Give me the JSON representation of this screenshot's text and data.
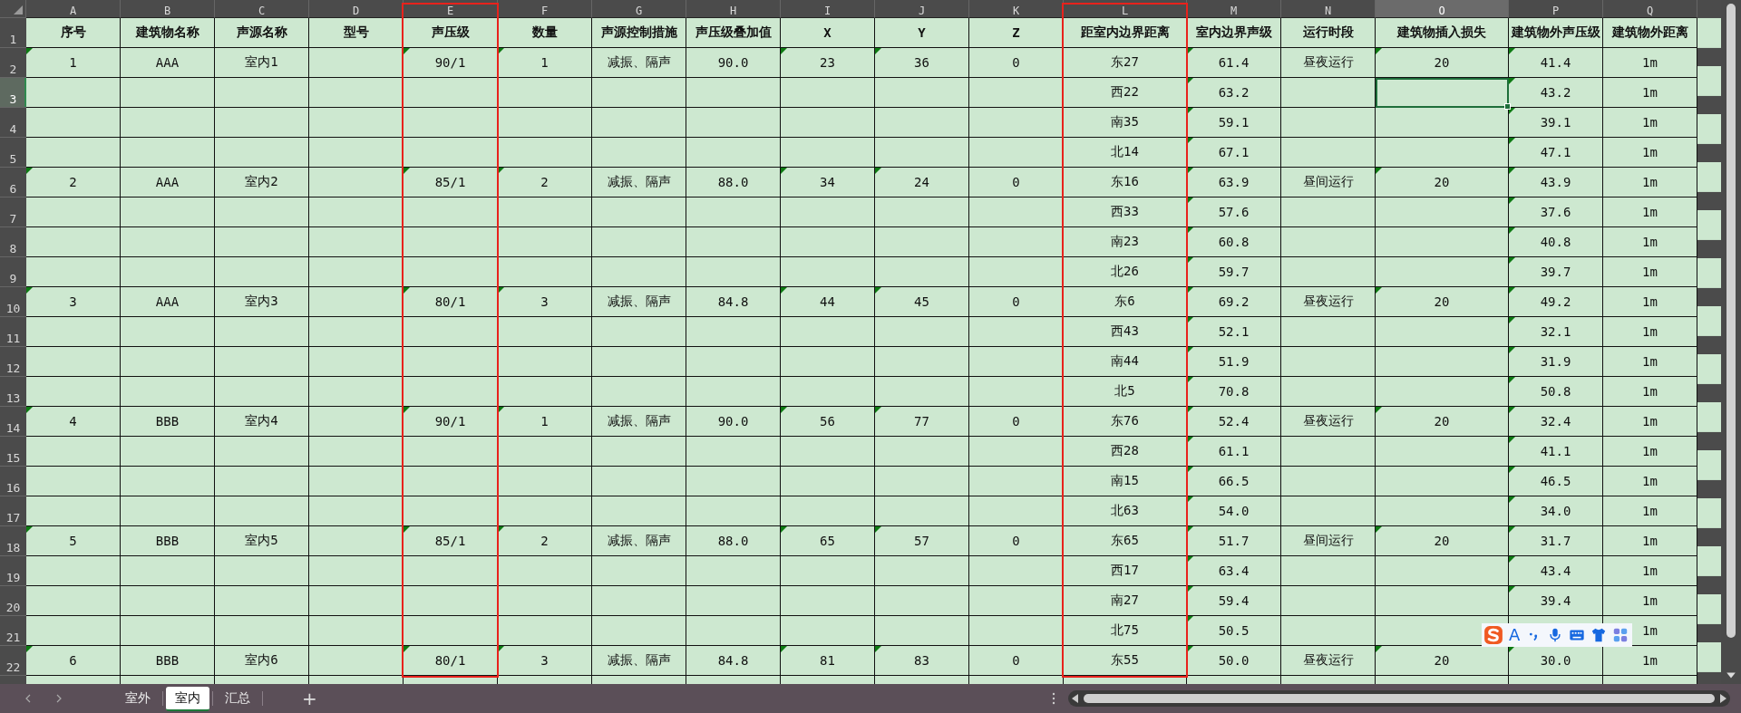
{
  "columns": [
    {
      "letter": "A",
      "selected": false,
      "highlighted": false
    },
    {
      "letter": "B",
      "selected": false,
      "highlighted": false
    },
    {
      "letter": "C",
      "selected": false,
      "highlighted": false
    },
    {
      "letter": "D",
      "selected": false,
      "highlighted": false
    },
    {
      "letter": "E",
      "selected": false,
      "highlighted": true
    },
    {
      "letter": "F",
      "selected": false,
      "highlighted": false
    },
    {
      "letter": "G",
      "selected": false,
      "highlighted": false
    },
    {
      "letter": "H",
      "selected": false,
      "highlighted": false
    },
    {
      "letter": "I",
      "selected": false,
      "highlighted": false
    },
    {
      "letter": "J",
      "selected": false,
      "highlighted": false
    },
    {
      "letter": "K",
      "selected": false,
      "highlighted": false
    },
    {
      "letter": "L",
      "selected": false,
      "highlighted": true
    },
    {
      "letter": "M",
      "selected": false,
      "highlighted": false
    },
    {
      "letter": "N",
      "selected": false,
      "highlighted": false
    },
    {
      "letter": "O",
      "selected": true,
      "highlighted": false
    },
    {
      "letter": "P",
      "selected": false,
      "highlighted": false
    },
    {
      "letter": "Q",
      "selected": false,
      "highlighted": false
    }
  ],
  "rows": [
    {
      "number": "1",
      "kind": "header",
      "selected": false,
      "cells": {
        "A": "序号",
        "B": "建筑物名称",
        "C": "声源名称",
        "D": "型号",
        "E": "声压级",
        "F": "数量",
        "G": "声源控制措施",
        "H": "声压级叠加值",
        "I": "X",
        "J": "Y",
        "K": "Z",
        "L": "距室内边界距离",
        "M": "室内边界声级",
        "N": "运行时段",
        "O": "建筑物插入损失",
        "P": "建筑物外声压级",
        "Q": "建筑物外距离"
      },
      "markers": {}
    },
    {
      "number": "2",
      "kind": "data",
      "selected": false,
      "cells": {
        "A": "1",
        "B": "AAA",
        "C": "室内1",
        "E": "90/1",
        "F": "1",
        "G": "减振、隔声",
        "H": "90.0",
        "I": "23",
        "J": "36",
        "K": "0",
        "L": "东27",
        "M": "61.4",
        "N": "昼夜运行",
        "O": "20",
        "P": "41.4",
        "Q": "1m"
      },
      "markers": {
        "A": true,
        "E": true,
        "F": true,
        "I": true,
        "J": true,
        "M": true,
        "O": true,
        "P": true
      }
    },
    {
      "number": "3",
      "kind": "data",
      "selected": true,
      "cells": {
        "L": "西22",
        "M": "63.2",
        "P": "43.2",
        "Q": "1m"
      },
      "markers": {
        "M": true,
        "P": true
      }
    },
    {
      "number": "4",
      "kind": "data",
      "selected": false,
      "cells": {
        "L": "南35",
        "M": "59.1",
        "P": "39.1",
        "Q": "1m"
      },
      "markers": {
        "M": true,
        "P": true
      }
    },
    {
      "number": "5",
      "kind": "data",
      "selected": false,
      "cells": {
        "L": "北14",
        "M": "67.1",
        "P": "47.1",
        "Q": "1m"
      },
      "markers": {
        "M": true,
        "P": true
      }
    },
    {
      "number": "6",
      "kind": "data",
      "selected": false,
      "cells": {
        "A": "2",
        "B": "AAA",
        "C": "室内2",
        "E": "85/1",
        "F": "2",
        "G": "减振、隔声",
        "H": "88.0",
        "I": "34",
        "J": "24",
        "K": "0",
        "L": "东16",
        "M": "63.9",
        "N": "昼间运行",
        "O": "20",
        "P": "43.9",
        "Q": "1m"
      },
      "markers": {
        "A": true,
        "E": true,
        "F": true,
        "I": true,
        "J": true,
        "M": true,
        "O": true,
        "P": true
      }
    },
    {
      "number": "7",
      "kind": "data",
      "selected": false,
      "cells": {
        "L": "西33",
        "M": "57.6",
        "P": "37.6",
        "Q": "1m"
      },
      "markers": {
        "M": true,
        "P": true
      }
    },
    {
      "number": "8",
      "kind": "data",
      "selected": false,
      "cells": {
        "L": "南23",
        "M": "60.8",
        "P": "40.8",
        "Q": "1m"
      },
      "markers": {
        "M": true,
        "P": true
      }
    },
    {
      "number": "9",
      "kind": "data",
      "selected": false,
      "cells": {
        "L": "北26",
        "M": "59.7",
        "P": "39.7",
        "Q": "1m"
      },
      "markers": {
        "M": true,
        "P": true
      }
    },
    {
      "number": "10",
      "kind": "data",
      "selected": false,
      "cells": {
        "A": "3",
        "B": "AAA",
        "C": "室内3",
        "E": "80/1",
        "F": "3",
        "G": "减振、隔声",
        "H": "84.8",
        "I": "44",
        "J": "45",
        "K": "0",
        "L": "东6",
        "M": "69.2",
        "N": "昼夜运行",
        "O": "20",
        "P": "49.2",
        "Q": "1m"
      },
      "markers": {
        "A": true,
        "E": true,
        "F": true,
        "I": true,
        "J": true,
        "M": true,
        "O": true,
        "P": true
      }
    },
    {
      "number": "11",
      "kind": "data",
      "selected": false,
      "cells": {
        "L": "西43",
        "M": "52.1",
        "P": "32.1",
        "Q": "1m"
      },
      "markers": {
        "M": true,
        "P": true
      }
    },
    {
      "number": "12",
      "kind": "data",
      "selected": false,
      "cells": {
        "L": "南44",
        "M": "51.9",
        "P": "31.9",
        "Q": "1m"
      },
      "markers": {
        "M": true,
        "P": true
      }
    },
    {
      "number": "13",
      "kind": "data",
      "selected": false,
      "cells": {
        "L": "北5",
        "M": "70.8",
        "P": "50.8",
        "Q": "1m"
      },
      "markers": {
        "M": true,
        "P": true
      }
    },
    {
      "number": "14",
      "kind": "data",
      "selected": false,
      "cells": {
        "A": "4",
        "B": "BBB",
        "C": "室内4",
        "E": "90/1",
        "F": "1",
        "G": "减振、隔声",
        "H": "90.0",
        "I": "56",
        "J": "77",
        "K": "0",
        "L": "东76",
        "M": "52.4",
        "N": "昼夜运行",
        "O": "20",
        "P": "32.4",
        "Q": "1m"
      },
      "markers": {
        "A": true,
        "E": true,
        "F": true,
        "I": true,
        "J": true,
        "M": true,
        "O": true,
        "P": true
      }
    },
    {
      "number": "15",
      "kind": "data",
      "selected": false,
      "cells": {
        "L": "西28",
        "M": "61.1",
        "P": "41.1",
        "Q": "1m"
      },
      "markers": {
        "M": true,
        "P": true
      }
    },
    {
      "number": "16",
      "kind": "data",
      "selected": false,
      "cells": {
        "L": "南15",
        "M": "66.5",
        "P": "46.5",
        "Q": "1m"
      },
      "markers": {
        "M": true,
        "P": true
      }
    },
    {
      "number": "17",
      "kind": "data",
      "selected": false,
      "cells": {
        "L": "北63",
        "M": "54.0",
        "P": "34.0",
        "Q": "1m"
      },
      "markers": {
        "M": true,
        "P": true
      }
    },
    {
      "number": "18",
      "kind": "data",
      "selected": false,
      "cells": {
        "A": "5",
        "B": "BBB",
        "C": "室内5",
        "E": "85/1",
        "F": "2",
        "G": "减振、隔声",
        "H": "88.0",
        "I": "65",
        "J": "57",
        "K": "0",
        "L": "东65",
        "M": "51.7",
        "N": "昼间运行",
        "O": "20",
        "P": "31.7",
        "Q": "1m"
      },
      "markers": {
        "A": true,
        "E": true,
        "F": true,
        "I": true,
        "J": true,
        "M": true,
        "O": true,
        "P": true
      }
    },
    {
      "number": "19",
      "kind": "data",
      "selected": false,
      "cells": {
        "L": "西17",
        "M": "63.4",
        "P": "43.4",
        "Q": "1m"
      },
      "markers": {
        "M": true,
        "P": true
      }
    },
    {
      "number": "20",
      "kind": "data",
      "selected": false,
      "cells": {
        "L": "南27",
        "M": "59.4",
        "P": "39.4",
        "Q": "1m"
      },
      "markers": {
        "M": true,
        "P": true
      }
    },
    {
      "number": "21",
      "kind": "data",
      "selected": false,
      "cells": {
        "L": "北75",
        "M": "50.5",
        "Q": "1m"
      },
      "markers": {
        "M": true
      }
    },
    {
      "number": "22",
      "kind": "data",
      "selected": false,
      "cells": {
        "A": "6",
        "B": "BBB",
        "C": "室内6",
        "E": "80/1",
        "F": "3",
        "G": "减振、隔声",
        "H": "84.8",
        "I": "81",
        "J": "83",
        "K": "0",
        "L": "东55",
        "M": "50.0",
        "N": "昼夜运行",
        "O": "20",
        "P": "30.0",
        "Q": "1m"
      },
      "markers": {
        "A": true,
        "E": true,
        "F": true,
        "I": true,
        "J": true,
        "M": true,
        "O": true,
        "P": true
      }
    }
  ],
  "sheet_tabs": [
    {
      "label": "室外",
      "selected": false
    },
    {
      "label": "室内",
      "selected": true
    },
    {
      "label": "汇总",
      "selected": false
    }
  ],
  "add_sheet": "+",
  "ime_toolbar": {
    "label": "A"
  }
}
